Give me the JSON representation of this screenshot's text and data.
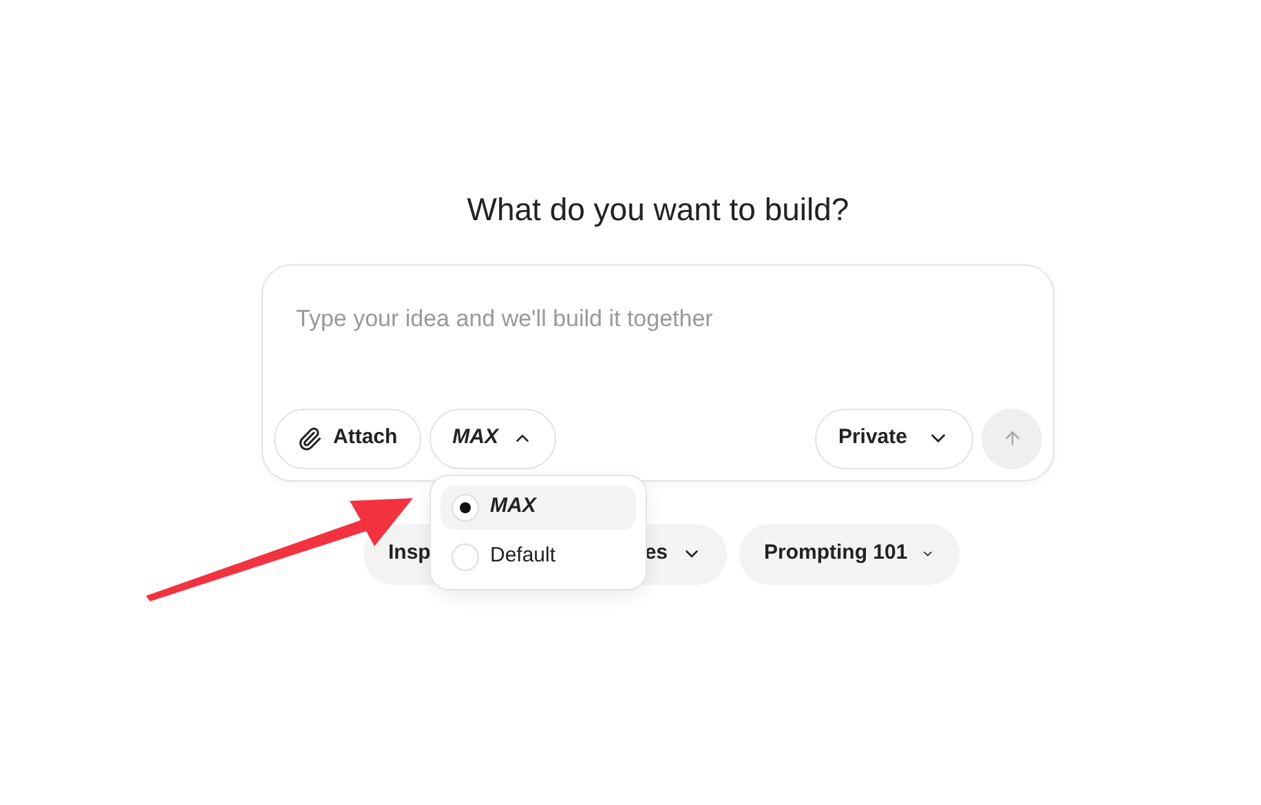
{
  "title": "What do you want to build?",
  "composer": {
    "placeholder": "Type your idea and we'll build it together",
    "attach": "Attach",
    "mode": "MAX",
    "mode_expanded": true,
    "visibility": "Private",
    "send_disabled": true
  },
  "mode_menu": [
    {
      "label": "MAX",
      "selected": true,
      "kind": "brand"
    },
    {
      "label": "Default",
      "selected": false,
      "kind": "plain"
    }
  ],
  "chips": [
    "Insp",
    "es",
    "Prompting 101"
  ]
}
